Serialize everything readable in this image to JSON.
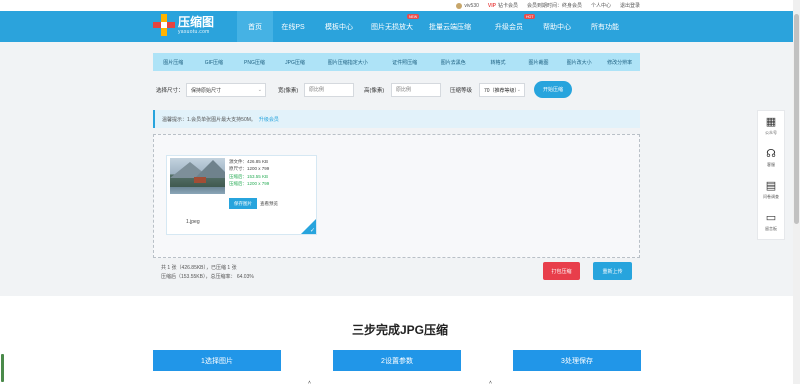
{
  "topbar": {
    "user": "viv530",
    "vip_label": "VIP",
    "member": "钻卡会员",
    "expiry": "会员到期时间：终身会员",
    "center": "个人中心",
    "logout": "退出登录"
  },
  "logo": {
    "title": "压缩图",
    "subtitle": "yasuotu.com"
  },
  "nav": {
    "items": [
      {
        "label": "首页",
        "active": true
      },
      {
        "label": "在线PS"
      },
      {
        "label": "模板中心"
      },
      {
        "label": "图片无损放大",
        "badge": "NEW"
      },
      {
        "label": "批量云端压缩"
      },
      {
        "label": "升级会员",
        "badge": "HOT"
      },
      {
        "label": "帮助中心"
      },
      {
        "label": "所有功能"
      }
    ]
  },
  "toolbar": {
    "tools": [
      "图片压缩",
      "GIF压缩",
      "PNG压缩",
      "JPG压缩",
      "图片压缩指定大小",
      "证件照压缩",
      "图片去黑色",
      "转格式",
      "图片裁图",
      "图片改大小",
      "修改分辨率"
    ]
  },
  "form": {
    "size_label": "选择尺寸：",
    "size_value": "保持原始尺寸",
    "width_label": "宽(像素)",
    "width_placeholder": "原比例",
    "height_label": "高(像素)",
    "height_placeholder": "原比例",
    "level_label": "压缩等级",
    "level_value": "70（推荐等级）",
    "start_button": "开始压缩"
  },
  "notice": {
    "text": "温馨提示：1.会员单张图片最大支持50M。",
    "link": "升级会员"
  },
  "file": {
    "original_size": "源文件：426.85 KB",
    "original_dims": "原尺寸：1200 x 799",
    "compressed_size": "压缩后：153.55 KB",
    "compressed_dims": "压缩后：1200 x 799",
    "save_button": "保存图片",
    "preview_link": "查看预览",
    "name": "1.jpeg"
  },
  "summary": {
    "line1": "共 1 张（426.85KB），已压缩 1 张",
    "line2": "压缩后（153.55KB），总压缩率： 64.03%"
  },
  "actions": {
    "pack": "打包压缩",
    "reupload": "重新上传"
  },
  "steps": {
    "title": "三步完成JPG压缩",
    "items": [
      "1选择图片",
      "2设置参数",
      "3处理保存"
    ]
  },
  "side": {
    "items": [
      {
        "label": "公众号",
        "icon": "qrcode-icon"
      },
      {
        "label": "客服",
        "icon": "headset-icon"
      },
      {
        "label": "问卷调查",
        "icon": "clipboard-icon"
      },
      {
        "label": "留言板",
        "icon": "message-icon"
      }
    ]
  },
  "colors": {
    "brand": "#2ba3dc",
    "accent_red": "#e83e4b",
    "success": "#2aad57"
  }
}
